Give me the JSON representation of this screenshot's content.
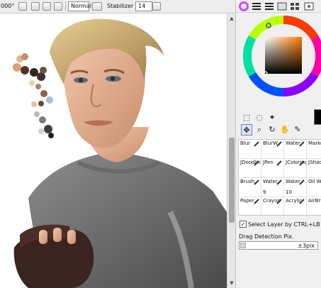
{
  "toolbar": {
    "zoom_fragment": "000°",
    "blend_mode": "Normal",
    "stabilizer_label": "Stabilizer",
    "stabilizer_value": "14"
  },
  "tools": {
    "brushes": [
      {
        "label": "Blur",
        "size": ""
      },
      {
        "label": "BlurW",
        "size": ""
      },
      {
        "label": "Water",
        "size": ""
      },
      {
        "label": "Marke",
        "size": ""
      },
      {
        "label": "JDoodlin",
        "size": ""
      },
      {
        "label": "JPen",
        "size": ""
      },
      {
        "label": "JColoring",
        "size": ""
      },
      {
        "label": "JShad",
        "size": ""
      },
      {
        "label": "Brush",
        "size": ""
      },
      {
        "label": "Water",
        "size": "9"
      },
      {
        "label": "Water",
        "size": "10"
      },
      {
        "label": "Oil Wa",
        "size": ""
      },
      {
        "label": "Paper",
        "size": ""
      },
      {
        "label": "Crayon",
        "size": ""
      },
      {
        "label": "Acrylic",
        "size": ""
      },
      {
        "label": "AirBru",
        "size": ""
      }
    ]
  },
  "options": {
    "select_layer_label": "Select Layer by CTRL+LB",
    "select_layer_checked": true,
    "drag_detection_label": "Drag Detection Pix.",
    "drag_detection_value": "±3pix"
  },
  "colors": {
    "current": "#000000",
    "picker_hue": "#ff7a00"
  }
}
